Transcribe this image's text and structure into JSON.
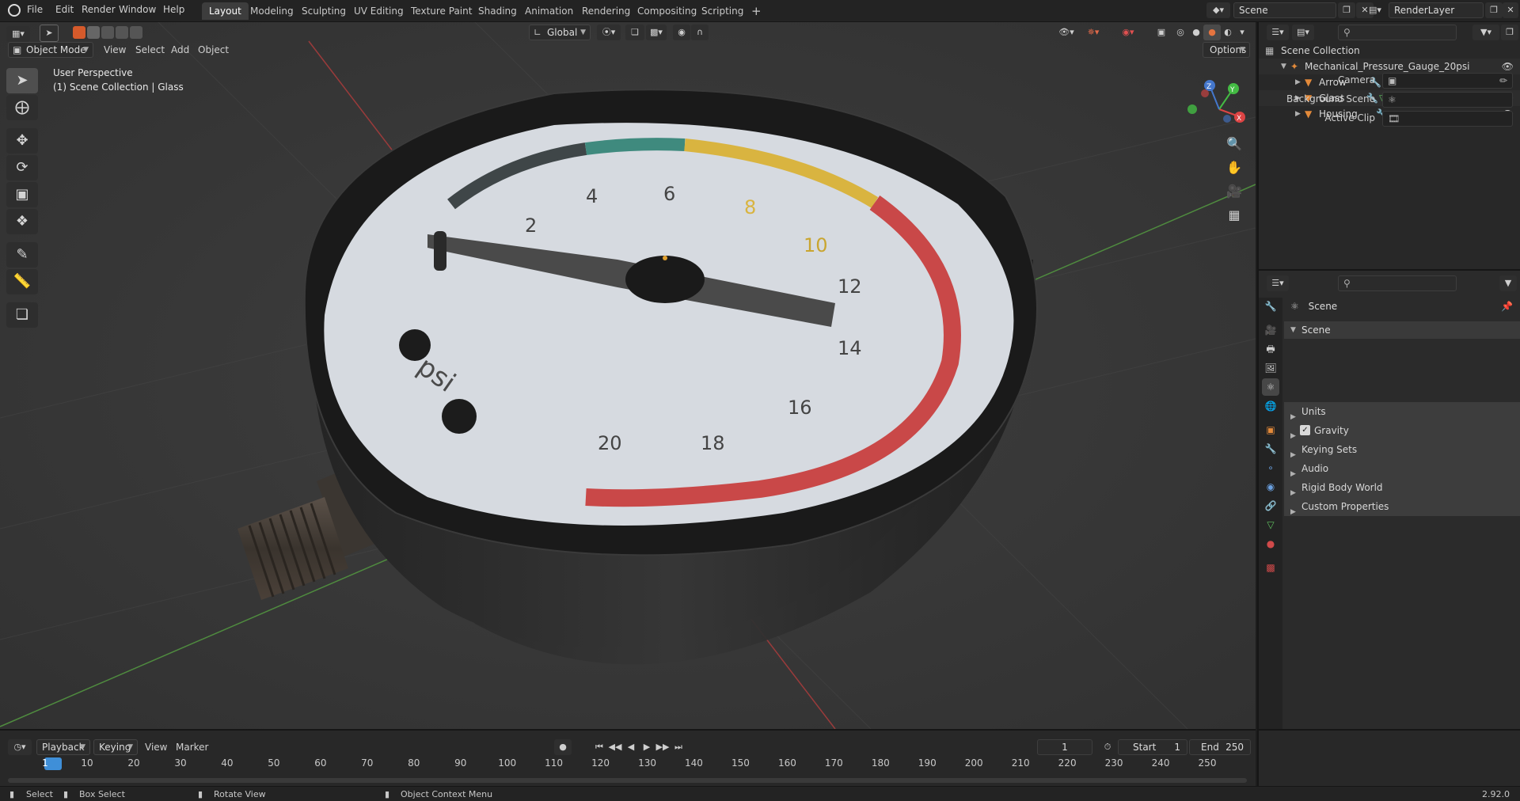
{
  "topbar": {
    "menus": [
      "File",
      "Edit",
      "Render",
      "Window",
      "Help"
    ],
    "workspaces": [
      "Layout",
      "Modeling",
      "Sculpting",
      "UV Editing",
      "Texture Paint",
      "Shading",
      "Animation",
      "Rendering",
      "Compositing",
      "Scripting"
    ],
    "active_workspace": "Layout",
    "add_tab_icon": "+",
    "scene_name": "Scene",
    "view_layer_name": "RenderLayer"
  },
  "viewport": {
    "mode": "Object Mode",
    "menus": [
      "View",
      "Select",
      "Add",
      "Object"
    ],
    "transform_orientation": "Global",
    "options_label": "Options",
    "perspective_label": "User Perspective",
    "collection_label": "(1) Scene Collection | Glass",
    "gizmo_axes": [
      "X",
      "Y",
      "Z"
    ],
    "tools": [
      "select-box-tool",
      "cursor-tool",
      "move-tool",
      "rotate-tool",
      "scale-tool",
      "transform-tool",
      "annotate-tool",
      "measure-tool",
      "add-cube-tool"
    ],
    "nav_icons": [
      "zoom-icon",
      "pan-icon",
      "camera-view-icon",
      "ortho-grid-icon"
    ]
  },
  "gauge": {
    "unit": "psi",
    "dial_numbers": [
      "2",
      "4",
      "6",
      "8",
      "10",
      "12",
      "14",
      "16",
      "18",
      "20"
    ],
    "zone_colors": {
      "low": "#3f4648",
      "normal": "#3f8a7e",
      "caution": "#d9b440",
      "danger": "#c94848"
    },
    "needle_value": 1.5
  },
  "outliner": {
    "root": "Scene Collection",
    "collection": "Mechanical_Pressure_Gauge_20psi",
    "objects": [
      "Arrow",
      "Glass",
      "Housing"
    ]
  },
  "properties": {
    "context_title": "Scene",
    "panel_title": "Scene",
    "fields": [
      {
        "label": "Camera"
      },
      {
        "label": "Background Scene"
      },
      {
        "label": "Active Clip"
      }
    ],
    "subpanels": [
      "Units",
      "Gravity",
      "Keying Sets",
      "Audio",
      "Rigid Body World",
      "Custom Properties"
    ],
    "gravity_checked": true
  },
  "timeline": {
    "menus": [
      "Playback",
      "Keying",
      "View",
      "Marker"
    ],
    "current_frame": "1",
    "start_label": "Start",
    "start": "1",
    "end_label": "End",
    "end": "250",
    "ticks": [
      "1",
      "10",
      "20",
      "30",
      "40",
      "50",
      "60",
      "70",
      "80",
      "90",
      "100",
      "110",
      "120",
      "130",
      "140",
      "150",
      "160",
      "170",
      "180",
      "190",
      "200",
      "210",
      "220",
      "230",
      "240",
      "250"
    ]
  },
  "statusbar": {
    "select": "Select",
    "box_select": "Box Select",
    "rotate_view": "Rotate View",
    "context_menu": "Object Context Menu",
    "version": "2.92.0"
  }
}
